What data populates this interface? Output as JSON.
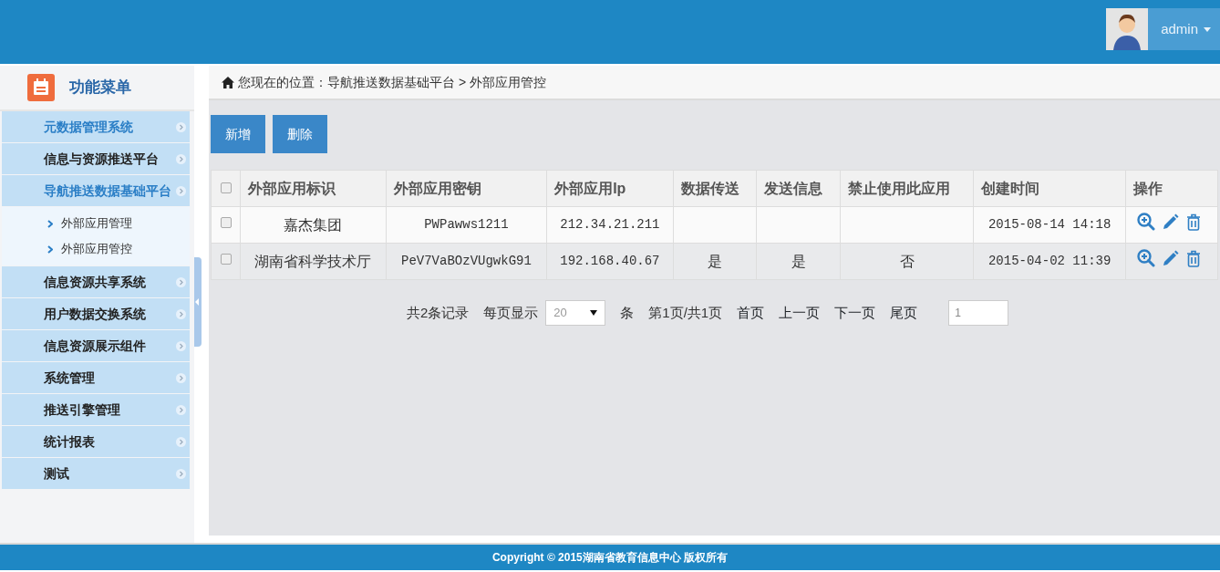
{
  "header": {
    "user": "admin"
  },
  "sidebar": {
    "title": "功能菜单",
    "items": [
      {
        "label": "元数据管理系统",
        "selected": true
      },
      {
        "label": "信息与资源推送平台",
        "selected": false
      },
      {
        "label": "导航推送数据基础平台",
        "selected": true,
        "children": [
          {
            "label": "外部应用管理"
          },
          {
            "label": "外部应用管控"
          }
        ]
      },
      {
        "label": "信息资源共享系统",
        "selected": false
      },
      {
        "label": "用户数据交换系统",
        "selected": false
      },
      {
        "label": "信息资源展示组件",
        "selected": false
      },
      {
        "label": "系统管理",
        "selected": false
      },
      {
        "label": "推送引擎管理",
        "selected": false
      },
      {
        "label": "统计报表",
        "selected": false
      },
      {
        "label": "测试",
        "selected": false
      }
    ]
  },
  "breadcrumb": "您现在的位置：导航推送数据基础平台 > 外部应用管控",
  "buttons": [
    "新增",
    "删除"
  ],
  "table": {
    "header_checked": false,
    "columns": [
      "外部应用标识",
      "外部应用密钥",
      "外部应用Ip",
      "数据传送",
      "发送信息",
      "禁止使用此应用",
      "创建时间",
      "操作"
    ],
    "rows": [
      {
        "checked": false,
        "cells": [
          "嘉杰集团",
          "PWPawws1211",
          "212.34.21.211",
          "",
          "",
          "",
          "2015-08-14 14:18"
        ]
      },
      {
        "checked": false,
        "cells": [
          "湖南省科学技术厅",
          "PeV7VaBOzVUgwkG91",
          "192.168.40.67",
          "是",
          "是",
          "否",
          "2015-04-02 11:39"
        ]
      }
    ]
  },
  "pagination": {
    "total": "共2条记录",
    "per_page_label": "每页显示",
    "per_page": "20",
    "unit": "条",
    "page_info": "第1页/共1页",
    "links": [
      "首页",
      "上一页",
      "下一页",
      "尾页"
    ],
    "jump_value": "1"
  },
  "footer": "Copyright © 2015湖南省教育信息中心 版权所有"
}
